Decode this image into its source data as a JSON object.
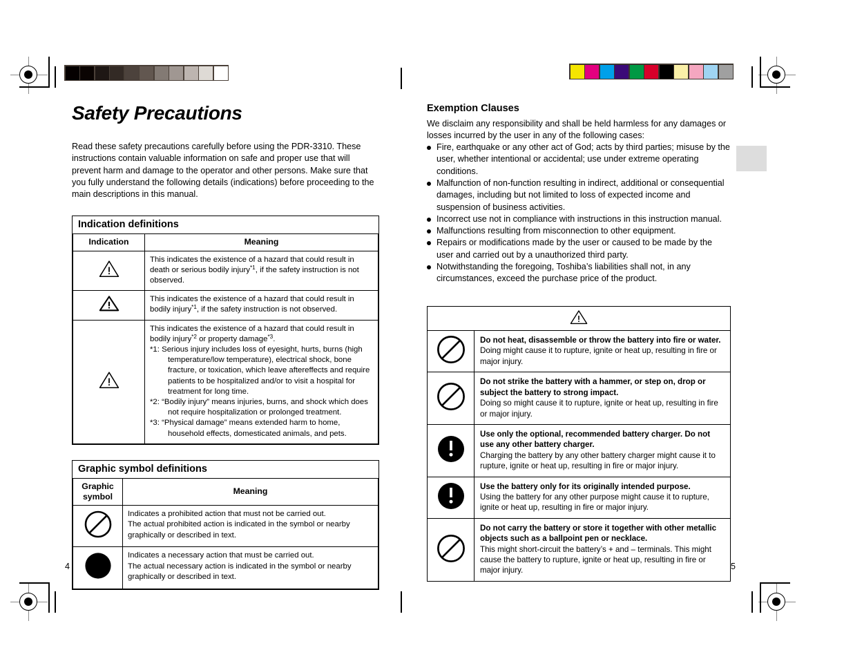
{
  "document": {
    "title": "Safety Precautions",
    "intro": "Read these safety precautions carefully before using the PDR-3310. These instructions contain valuable information on safe and proper use that will prevent harm and damage to the operator and other persons. Make sure that you fully understand the following details (indications) before proceeding to the main descriptions in this manual.",
    "page_left": "4",
    "page_right": "5"
  },
  "indication_table": {
    "box_title": "Indication definitions",
    "headers": [
      "Indication",
      "Meaning"
    ],
    "rows": [
      {
        "symbol": "warning-triangle-icon",
        "text_a": "This indicates the existence of a hazard that could result in death or serious bodily injury",
        "sup_a": "*1",
        "text_b": ", if the safety instruction is not observed."
      },
      {
        "symbol": "warning-triangle-icon",
        "text_a": "This indicates the existence of a hazard that could result in bodily injury",
        "sup_a": "*1",
        "text_b": ", if the safety instruction is not observed."
      },
      {
        "symbol": "warning-triangle-icon",
        "text_a": "This indicates the existence of a hazard that could result in bodily injury",
        "sup_a": "*2",
        "text_b": " or property damage",
        "sup_b": "*3",
        "text_c": ".",
        "footnotes": [
          "*1: Serious injury includes loss of eyesight, hurts, burns (high temperature/low temperature), electrical shock, bone fracture, or toxication, which leave aftereffects and require patients to be hospitalized and/or to visit a hospital for treatment for long time.",
          "*2: “Bodily injury” means injuries, burns, and shock which does not require hospitalization or prolonged treatment.",
          "*3: “Physical damage” means extended harm to home, household effects, domesticated animals, and pets."
        ]
      }
    ]
  },
  "graphic_symbol_table": {
    "box_title": "Graphic symbol definitions",
    "headers": [
      "Graphic symbol",
      "Meaning"
    ],
    "rows": [
      {
        "symbol": "prohibition-icon",
        "line1": "Indicates a prohibited action that must not be carried out.",
        "line2": "The actual prohibited action is indicated in the symbol or nearby",
        "line3": "graphically or described in text."
      },
      {
        "symbol": "mandatory-filled-circle-icon",
        "line1": "Indicates a necessary action that must be carried out.",
        "line2": "The actual necessary action is indicated in the symbol or nearby",
        "line3": "graphically or described in text."
      }
    ]
  },
  "exemption": {
    "heading": "Exemption Clauses",
    "intro": "We disclaim any responsibility and shall be held harmless for any damages or losses incurred by the user in any of the following cases:",
    "bullets": [
      "Fire, earthquake or any other act of God; acts by third parties; misuse by the user, whether intentional or accidental; use under extreme operating conditions.",
      "Malfunction of non-function resulting in indirect, additional or consequential damages, including but not limited to loss of expected income and suspension of business activities.",
      "Incorrect use not in compliance with instructions in this instruction manual.",
      "Malfunctions resulting from misconnection to other equipment.",
      "Repairs or modifications made by the user or caused to be made by the user and carried out by a unauthorized third party.",
      "Notwithstanding the foregoing, Toshiba’s liabilities shall not, in any circumstances, exceed the purchase price of the product."
    ]
  },
  "battery_warning_table": {
    "header_symbol": "warning-triangle-icon",
    "rows": [
      {
        "symbol": "prohibition-icon",
        "lead": "Do not heat, disassemble or throw the battery into fire or water.",
        "body": "Doing might cause it to rupture, ignite or heat up, resulting in fire or major injury."
      },
      {
        "symbol": "prohibition-icon",
        "lead": "Do not strike the battery with a hammer, or step on, drop or subject the battery to strong impact.",
        "body": "Doing so might cause it to rupture, ignite or heat up, resulting in fire or major injury."
      },
      {
        "symbol": "mandatory-exclamation-icon",
        "lead": "Use only the optional, recommended battery charger. Do not use any other battery charger.",
        "body": "Charging the battery by any other battery charger might cause it to rupture, ignite or heat up, resulting in fire or major injury."
      },
      {
        "symbol": "mandatory-exclamation-icon",
        "lead": "Use the battery only for its originally intended purpose.",
        "body": "Using the battery for any other purpose might cause it to rupture, ignite or heat up, resulting in fire or major injury."
      },
      {
        "symbol": "prohibition-icon",
        "lead": "Do not carry the battery or store it together with other metallic objects such as a ballpoint pen or necklace.",
        "body": "This might short-circuit the battery’s + and – terminals. This might cause the battery to rupture, ignite or heat up, resulting in fire or major injury."
      }
    ]
  },
  "print_marks": {
    "gray_bar_colors": [
      "#050000",
      "#0a0402",
      "#1e1714",
      "#332a25",
      "#4c423c",
      "#625750",
      "#837a74",
      "#a09792",
      "#bdb5b0",
      "#dedad5",
      "#ffffff"
    ],
    "color_bar_colors": [
      "#f5e500",
      "#e3007f",
      "#00a0e9",
      "#3b0a78",
      "#009944",
      "#d7002a",
      "#000000",
      "#faf0a8",
      "#f5a7c0",
      "#9fd4f2",
      "#a0a0a0"
    ],
    "gray_tab_color": "#dddddd"
  }
}
